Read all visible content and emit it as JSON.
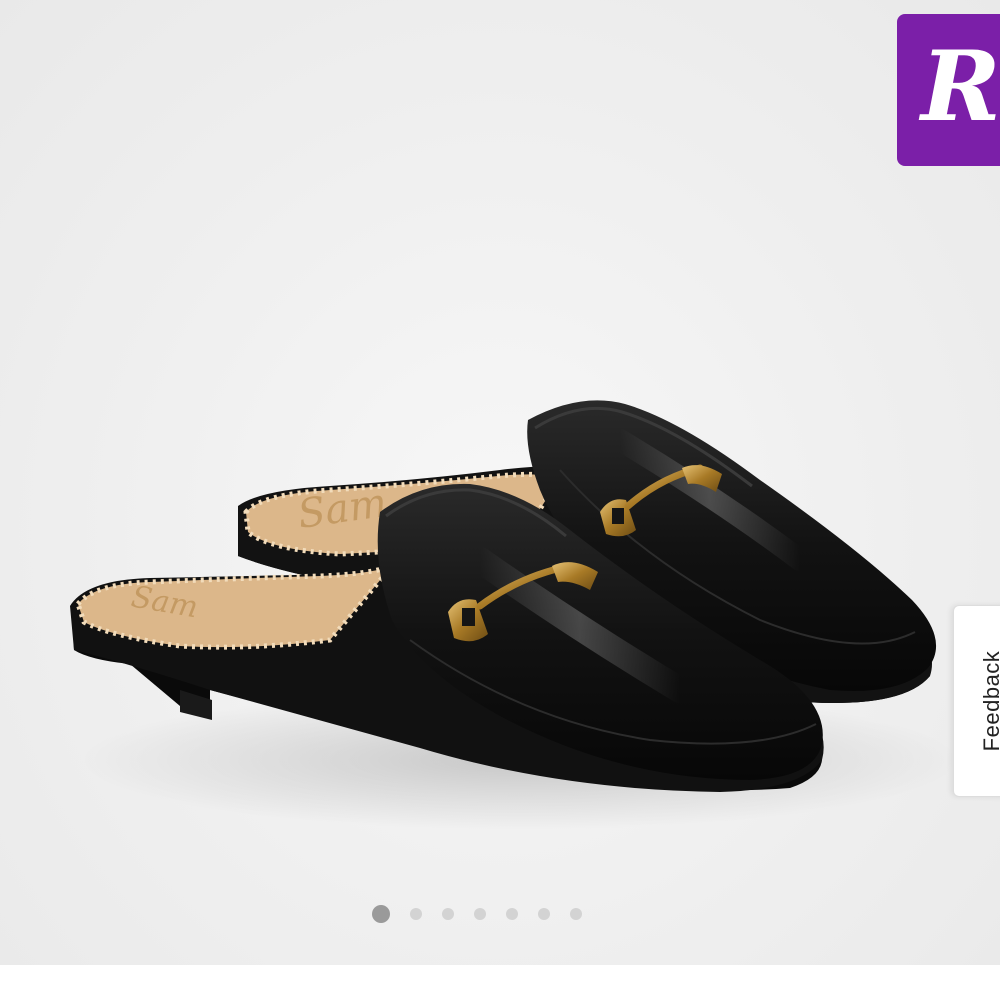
{
  "badge": {
    "letter": "R",
    "color": "#7b1fa8"
  },
  "feedback": {
    "label": "Feedback"
  },
  "carousel": {
    "total": 7,
    "active_index": 0
  },
  "insole_print": {
    "back_shoe": "Sam",
    "front_shoe": "Sam"
  },
  "colors": {
    "shoe": "#141414",
    "hardware": "#b98a2e",
    "insole": "#dcb78a"
  }
}
